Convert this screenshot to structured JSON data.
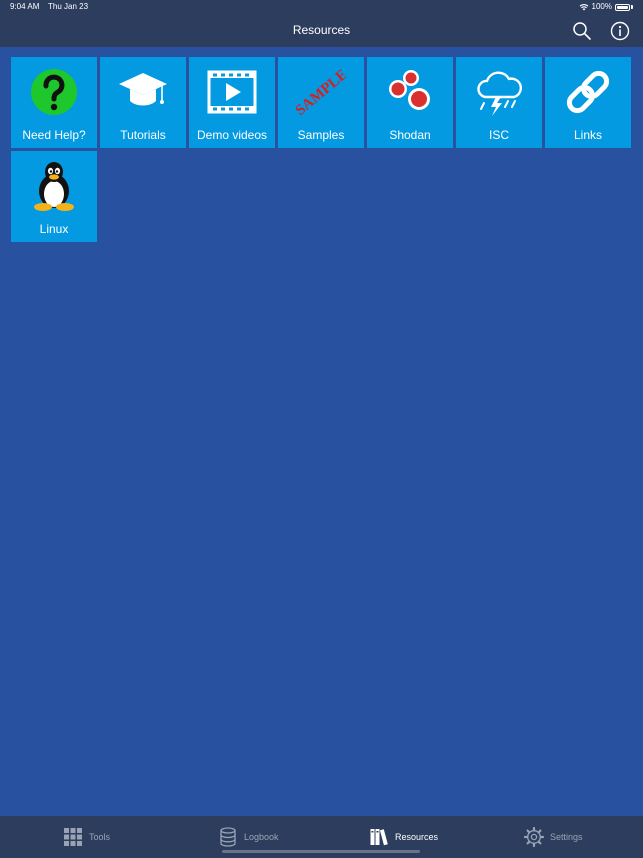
{
  "status": {
    "time": "9:04 AM",
    "date": "Thu Jan 23",
    "battery": "100%"
  },
  "nav": {
    "title": "Resources"
  },
  "tiles": [
    {
      "label": "Need Help?",
      "icon": "question-icon"
    },
    {
      "label": "Tutorials",
      "icon": "graduation-cap-icon"
    },
    {
      "label": "Demo videos",
      "icon": "video-icon"
    },
    {
      "label": "Samples",
      "icon": "sample-stamp-icon",
      "stamp_text": "SAMPLE"
    },
    {
      "label": "Shodan",
      "icon": "shodan-icon"
    },
    {
      "label": "ISC",
      "icon": "storm-cloud-icon"
    },
    {
      "label": "Links",
      "icon": "link-chain-icon"
    },
    {
      "label": "Linux",
      "icon": "tux-penguin-icon"
    }
  ],
  "tabs": [
    {
      "label": "Tools",
      "icon": "grid-icon"
    },
    {
      "label": "Logbook",
      "icon": "database-icon"
    },
    {
      "label": "Resources",
      "icon": "books-icon",
      "active": true
    },
    {
      "label": "Settings",
      "icon": "gear-icon"
    }
  ],
  "colors": {
    "background": "#2852a0",
    "bar": "#2c3d5e",
    "tile": "#049ae1",
    "help_green": "#1ec82c",
    "stamp_red": "#d42020"
  }
}
